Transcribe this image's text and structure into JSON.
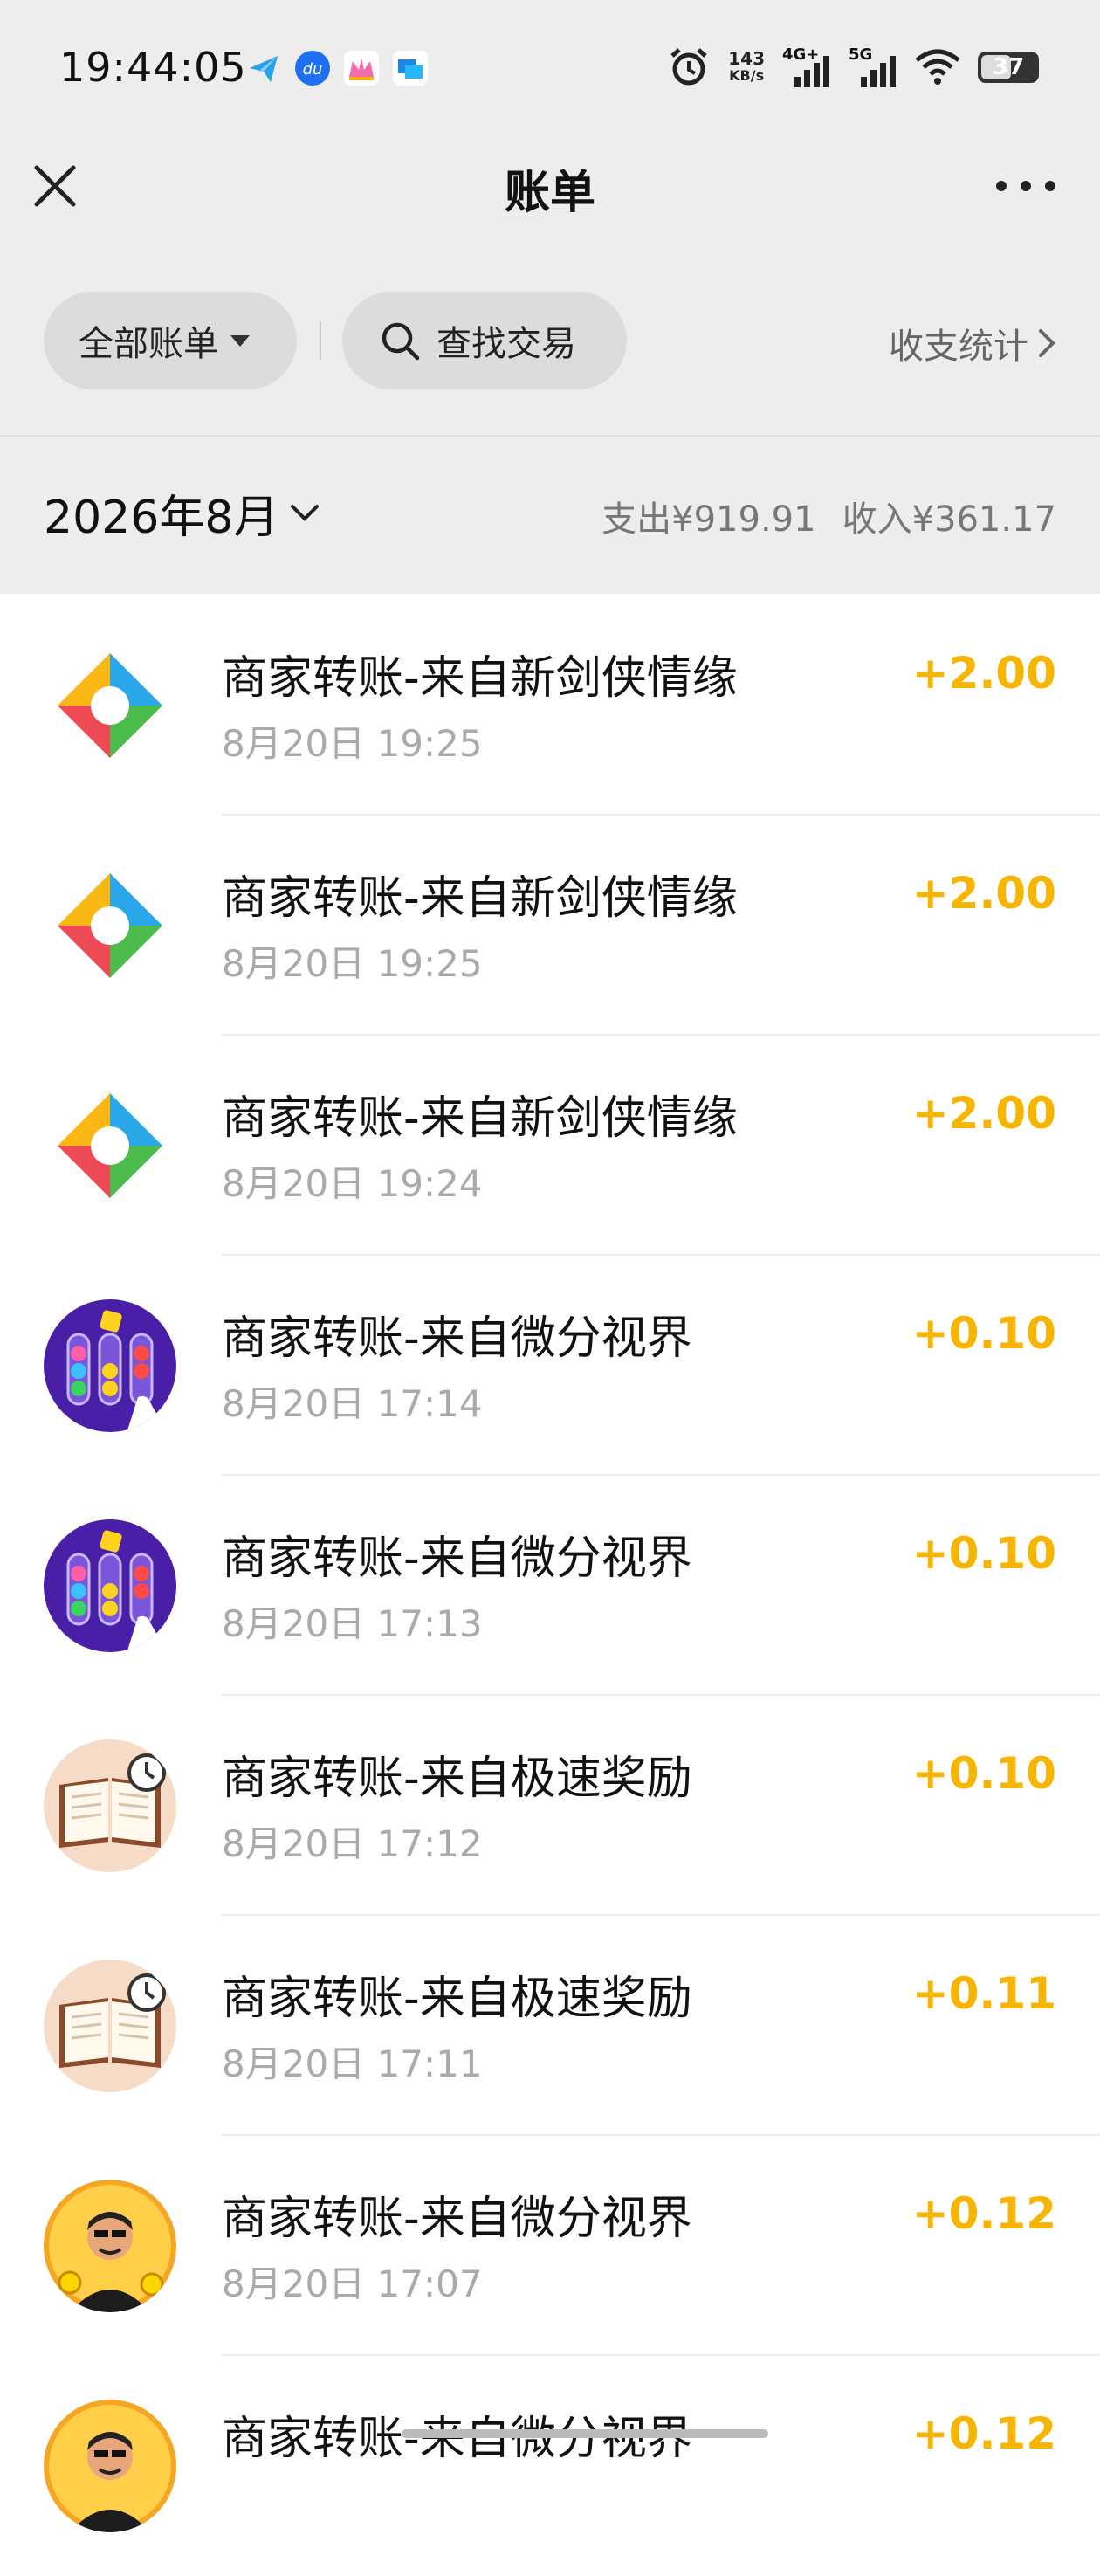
{
  "status_bar": {
    "time": "19:44:05",
    "net_speed_value": "143",
    "net_speed_unit": "KB/s",
    "sim1": "4G+",
    "sim2": "5G",
    "battery": "37"
  },
  "navbar": {
    "title": "账单"
  },
  "filters": {
    "all_bills_label": "全部账单",
    "search_label": "查找交易",
    "stats_label": "收支统计"
  },
  "month_summary": {
    "month": "2026年8月",
    "expense": "支出¥919.91",
    "income": "收入¥361.17"
  },
  "transactions": [
    {
      "title": "商家转账-来自新剑侠情缘",
      "date": "8月20日 19:25",
      "amount": "+2.00",
      "icon": "compass-logo-icon"
    },
    {
      "title": "商家转账-来自新剑侠情缘",
      "date": "8月20日 19:25",
      "amount": "+2.00",
      "icon": "compass-logo-icon"
    },
    {
      "title": "商家转账-来自新剑侠情缘",
      "date": "8月20日 19:24",
      "amount": "+2.00",
      "icon": "compass-logo-icon"
    },
    {
      "title": "商家转账-来自微分视界",
      "date": "8月20日 17:14",
      "amount": "+0.10",
      "icon": "sort-tubes-game-icon"
    },
    {
      "title": "商家转账-来自微分视界",
      "date": "8月20日 17:13",
      "amount": "+0.10",
      "icon": "sort-tubes-game-icon"
    },
    {
      "title": "商家转账-来自极速奖励",
      "date": "8月20日 17:12",
      "amount": "+0.10",
      "icon": "book-clock-icon"
    },
    {
      "title": "商家转账-来自极速奖励",
      "date": "8月20日 17:11",
      "amount": "+0.11",
      "icon": "book-clock-icon"
    },
    {
      "title": "商家转账-来自微分视界",
      "date": "8月20日 17:07",
      "amount": "+0.12",
      "icon": "gold-man-avatar-icon"
    },
    {
      "title": "商家转账-来自微分视界",
      "date": "",
      "amount": "+0.12",
      "icon": "gold-man-avatar-icon"
    }
  ],
  "colors": {
    "amount": "#f7b500",
    "header_bg": "#ededed",
    "pill_bg": "#dcdcdc"
  }
}
